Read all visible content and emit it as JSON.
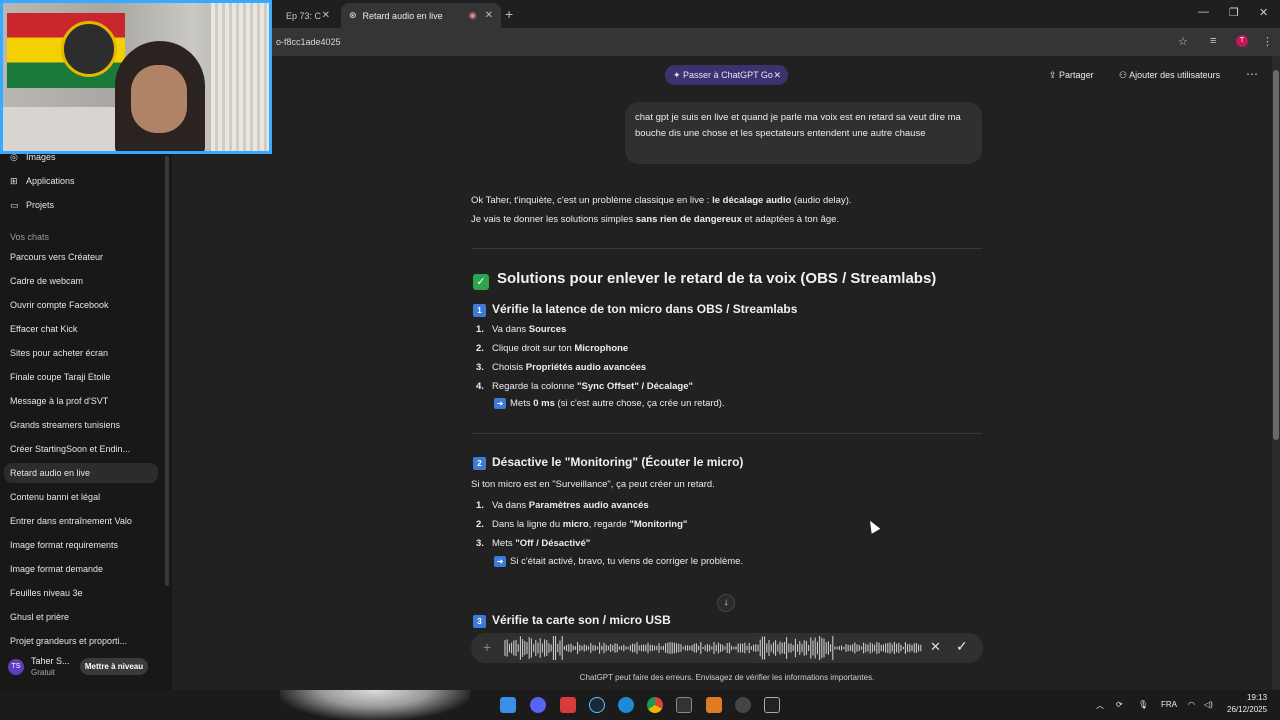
{
  "browser": {
    "tabs": [
      {
        "label": "Ep 73: C"
      },
      {
        "label": "Retard audio en live"
      }
    ],
    "url": "o-f8cc1ade4025"
  },
  "sidebar": {
    "top_items": [
      {
        "label": "Images",
        "icon": "images-icon"
      },
      {
        "label": "Applications",
        "icon": "apps-icon"
      },
      {
        "label": "Projets",
        "icon": "folder-icon"
      }
    ],
    "section_label": "Vos chats",
    "chats": [
      "Parcours vers Créateur",
      "Cadre de webcam",
      "Ouvrir compte Facebook",
      "Effacer chat Kick",
      "Sites pour acheter écran",
      "Finale coupe Taraji Etoile",
      "Message à la prof d'SVT",
      "Grands streamers tunisiens",
      "Créer StartingSoon et Endin...",
      "Retard audio en live",
      "Contenu banni et légal",
      "Entrer dans entraînement Valo",
      "Image format requirements",
      "Image format demande",
      "Feuilles niveau 3e",
      "Ghusl et prière",
      "Projet grandeurs et proporti..."
    ],
    "active_chat": "Retard audio en live",
    "user": {
      "initials": "TS",
      "name": "Taher S...",
      "plan": "Gratuit",
      "upgrade_label": "Mettre à niveau"
    }
  },
  "header": {
    "promo": "Passer à ChatGPT Go",
    "share": "Partager",
    "add_users": "Ajouter des utilisateurs"
  },
  "conversation": {
    "user_message": "chat gpt je suis en live et quand je parle ma voix est en retard sa veut dire ma bouche dis une chose et les spectateurs entendent une autre chause",
    "intro_1_a": "Ok Taher, t'inquiète, c'est un problème classique en live : ",
    "intro_1_b": "le décalage audio",
    "intro_1_c": " (audio delay).",
    "intro_2_a": "Je vais te donner les solutions simples ",
    "intro_2_b": "sans rien de dangereux",
    "intro_2_c": " et adaptées à ton âge.",
    "heading": "Solutions pour enlever le retard de ta voix (OBS / Streamlabs)",
    "s1": {
      "num": "1",
      "title": "Vérifie la latence de ton micro dans OBS / Streamlabs",
      "steps": [
        {
          "n": "1.",
          "a": "Va dans ",
          "b": "Sources",
          "c": ""
        },
        {
          "n": "2.",
          "a": "Clique droit sur ton ",
          "b": "Microphone",
          "c": ""
        },
        {
          "n": "3.",
          "a": "Choisis ",
          "b": "Propriétés audio avancées",
          "c": ""
        },
        {
          "n": "4.",
          "a": "Regarde la colonne ",
          "b": "\"Sync Offset\" / Décalage\"",
          "c": ""
        }
      ],
      "note_a": "Mets ",
      "note_b": "0 ms",
      "note_c": " (si c'est autre chose, ça crée un retard)."
    },
    "s2": {
      "num": "2",
      "title": "Désactive le \"Monitoring\" (Écouter le micro)",
      "intro": "Si ton micro est en \"Surveillance\", ça peut créer un retard.",
      "steps": [
        {
          "n": "1.",
          "a": "Va dans ",
          "b": "Paramètres audio avancés",
          "c": ""
        },
        {
          "n": "2.",
          "a": "Dans la ligne du ",
          "b": "micro",
          "c": ", regarde ",
          "d": "\"Monitoring\""
        },
        {
          "n": "3.",
          "a": "Mets ",
          "b": "\"Off / Désactivé\"",
          "c": ""
        }
      ],
      "note": "Si c'était activé, bravo, tu viens de corriger le problème."
    },
    "s3": {
      "num": "3",
      "title": "Vérifie ta carte son / micro USB"
    }
  },
  "composer": {
    "disclaimer": "ChatGPT peut faire des erreurs. Envisagez de vérifier les informations importantes."
  },
  "taskbar": {
    "lang": "FRA",
    "time": "19:13",
    "date": "26/12/2025"
  },
  "colors": {
    "accent_blue": "#3e7bd6",
    "check_green": "#2da44e",
    "promo_purple": "#3d3270",
    "webcam_border": "#35aaff"
  }
}
